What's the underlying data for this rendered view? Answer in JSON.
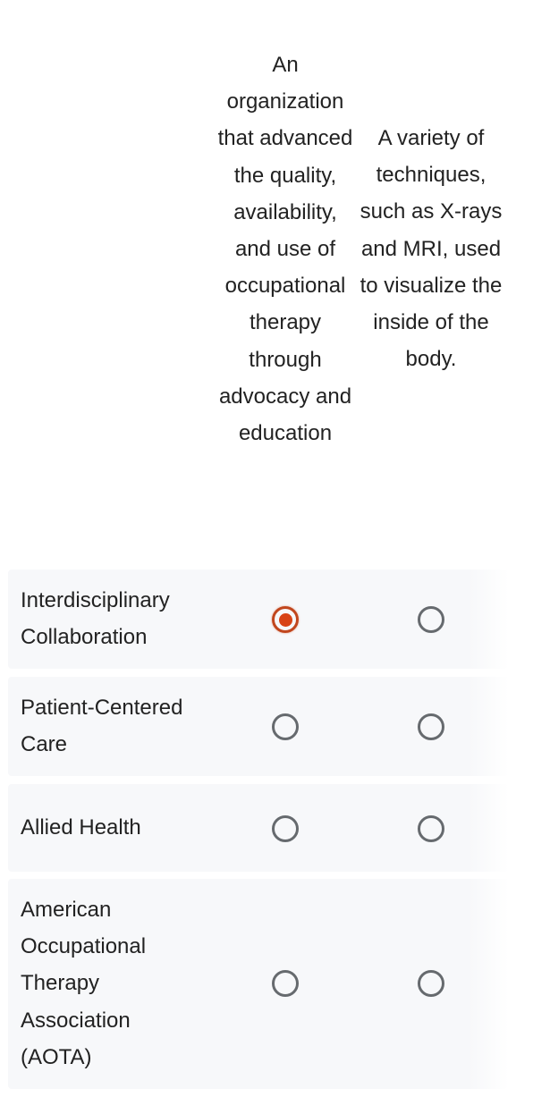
{
  "columns": [
    {
      "header": "An organization that advanced the quality, availability, and use of occupational therapy through advocacy and education"
    },
    {
      "header": "A variety of techniques, such as X-rays and MRI, used to visualize the inside of the body."
    }
  ],
  "rows": [
    {
      "label": "Interdisciplinary Collaboration",
      "selected_column": 0
    },
    {
      "label": "Patient-Centered Care",
      "selected_column": null
    },
    {
      "label": "Allied Health",
      "selected_column": null
    },
    {
      "label": "American Occupational Therapy Association (AOTA)",
      "selected_column": null
    }
  ],
  "colors": {
    "accent": "#d84315",
    "row_background": "#f7f8fa",
    "radio_border": "#666a6e",
    "text": "#222222"
  }
}
